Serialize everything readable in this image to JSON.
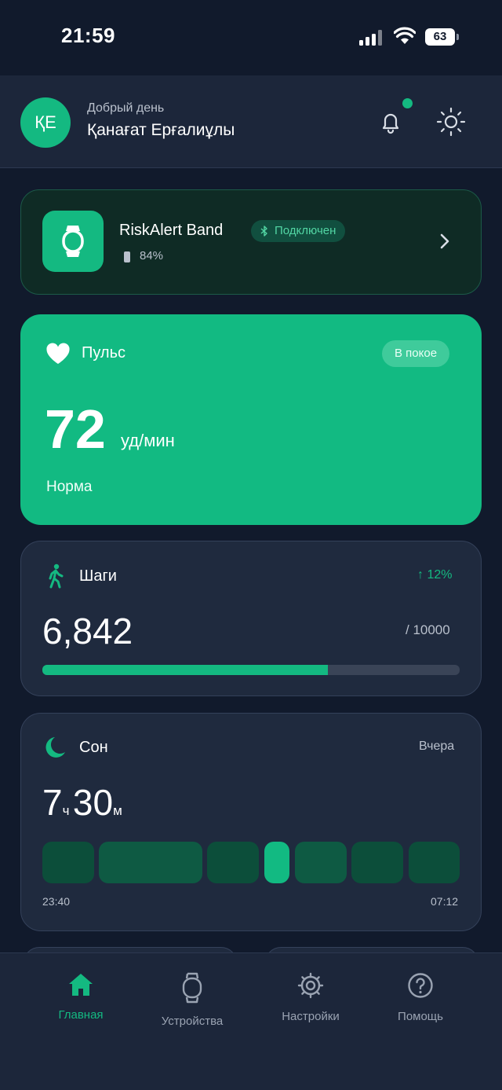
{
  "status_bar": {
    "time": "21:59",
    "battery_level": "63"
  },
  "header": {
    "avatar_initials": "ҚЕ",
    "greeting": "Добрый день",
    "user_name": "Қанағат Ерғалиұлы",
    "has_notification": true
  },
  "device": {
    "name": "RiskAlert Band",
    "connection_status": "Подключен",
    "battery": "84%",
    "icon": "watch-icon"
  },
  "pulse": {
    "title": "Пульс",
    "state_badge": "В покое",
    "value": "72",
    "unit": "уд/мин",
    "status": "Норма",
    "icon": "heart-icon"
  },
  "steps": {
    "title": "Шаги",
    "change": "↑ 12%",
    "value": "6,842",
    "goal": "/ 10000",
    "progress_fraction": 0.6842,
    "icon": "walk-icon"
  },
  "sleep": {
    "title": "Сон",
    "when": "Вчера",
    "hours": "7",
    "hours_unit": "ч",
    "minutes": "30",
    "minutes_unit": "м",
    "start_time": "23:40",
    "end_time": "07:12",
    "icon": "moon-icon",
    "stage_colors": [
      "#0c4e3a",
      "#0e5a43",
      "#0c4e3a",
      "#12ba82",
      "#0e5a43",
      "#0c4e3a",
      "#0c4e3a"
    ]
  },
  "nav": {
    "items": [
      {
        "label": "Главная",
        "icon": "home-icon",
        "active": true
      },
      {
        "label": "Устройства",
        "icon": "watch-icon",
        "active": false
      },
      {
        "label": "Настройки",
        "icon": "gear-icon",
        "active": false
      },
      {
        "label": "Помощь",
        "icon": "help-icon",
        "active": false
      }
    ]
  },
  "colors": {
    "accent": "#14b981",
    "background": "#111a2c",
    "card": "#1f2a3e"
  }
}
